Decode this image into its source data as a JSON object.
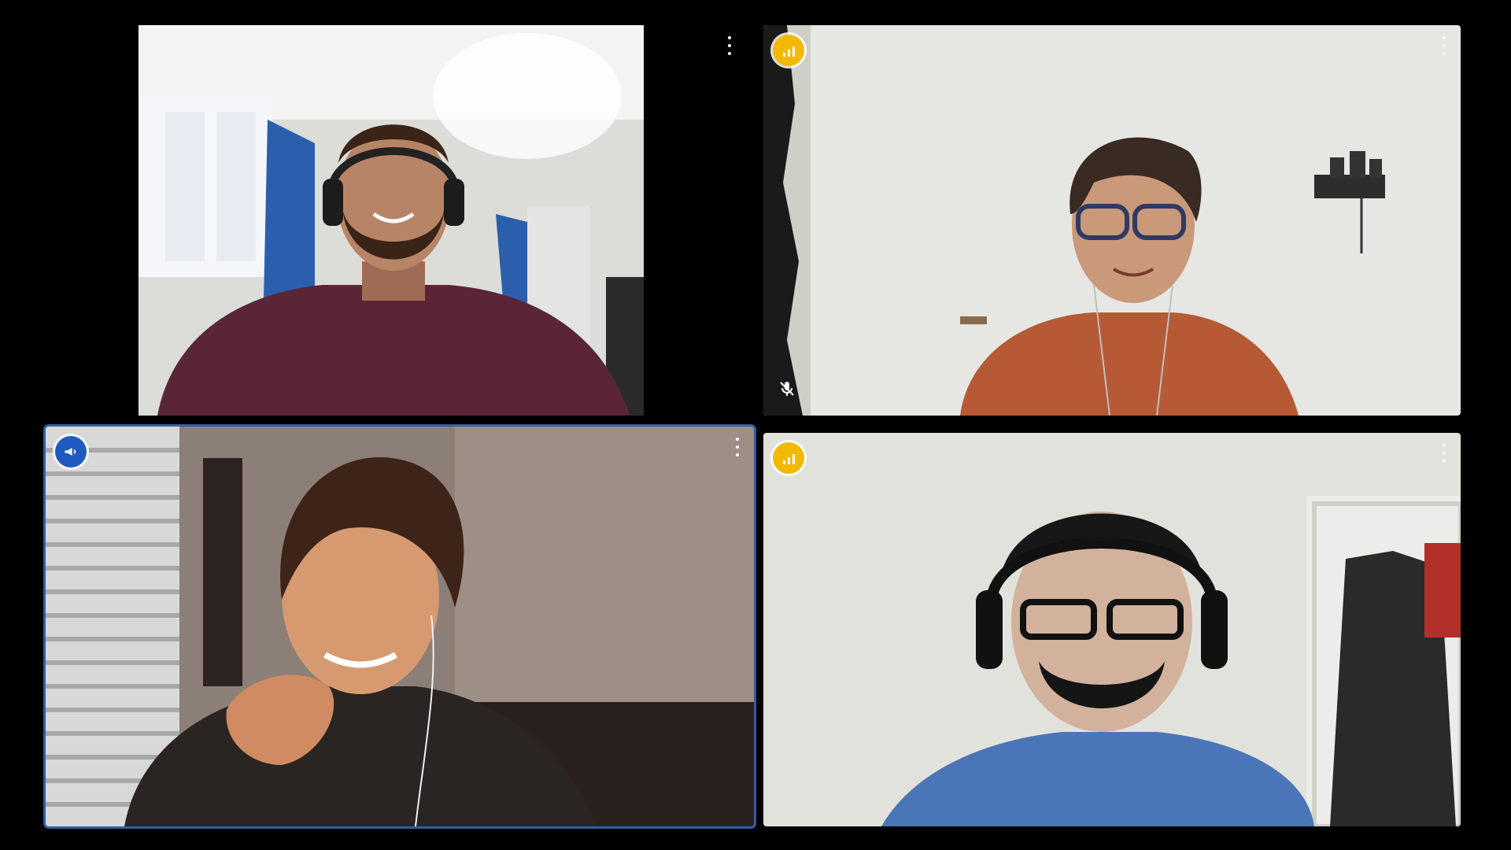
{
  "colors": {
    "background": "#000000",
    "active_outline": "#2f5fa8",
    "speaking_badge": "#f2b900",
    "presenter_badge": "#1f5bbf"
  },
  "participants": [
    {
      "position": "top-left",
      "status_icon": "none",
      "active": false,
      "muted": false,
      "menu_icon": "more-vert-icon"
    },
    {
      "position": "top-right",
      "status_icon": "audio-level-icon",
      "active": false,
      "muted": true,
      "menu_icon": "more-vert-icon"
    },
    {
      "position": "bottom-left",
      "status_icon": "megaphone-icon",
      "active": true,
      "muted": false,
      "menu_icon": "more-vert-icon"
    },
    {
      "position": "bottom-right",
      "status_icon": "audio-level-icon",
      "active": false,
      "muted": false,
      "menu_icon": "more-vert-icon"
    }
  ]
}
